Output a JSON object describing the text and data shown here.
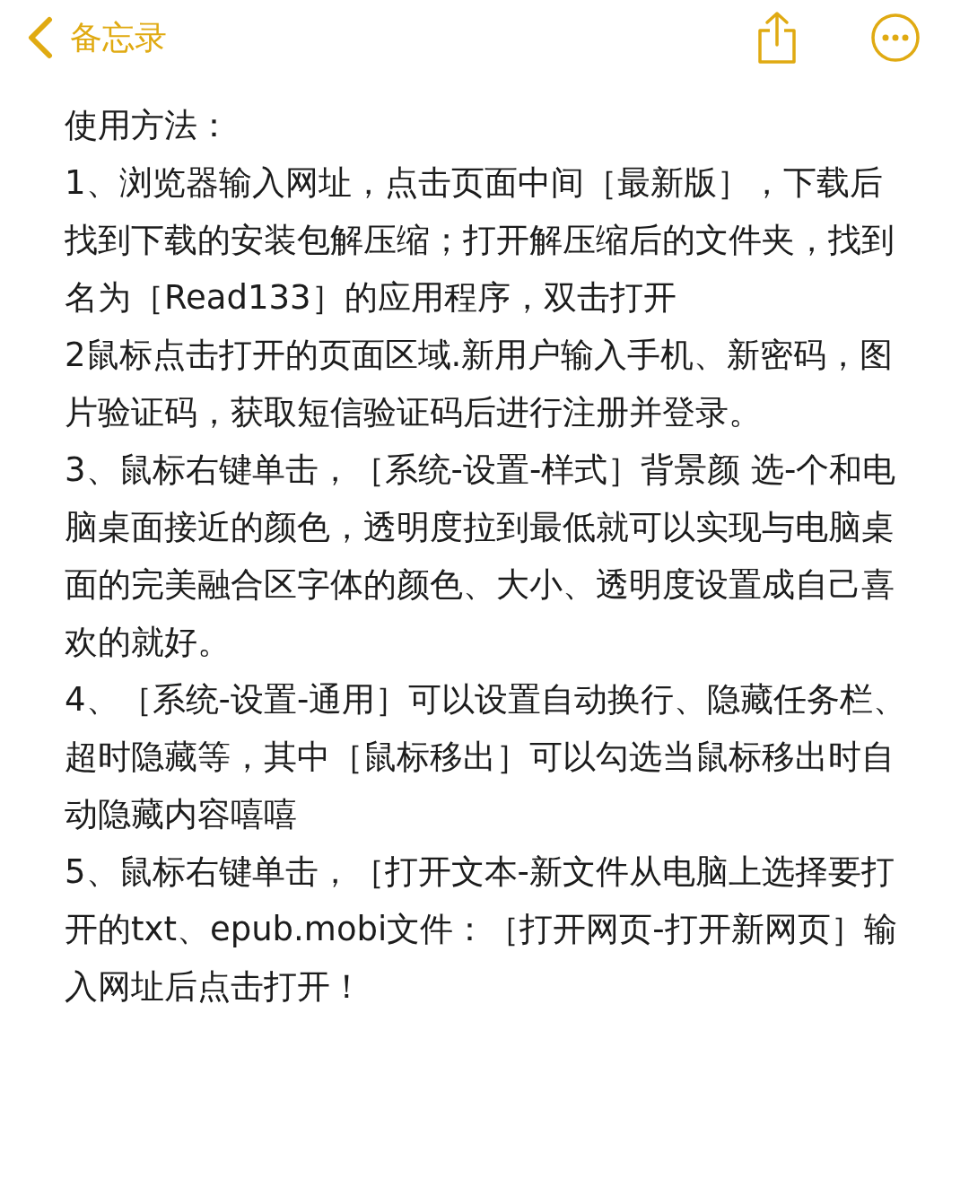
{
  "nav_bar": {
    "back_label": "备忘录"
  },
  "note": {
    "paragraphs": [
      "使用方法：",
      "1、浏览器输入网址，点击页面中间［最新版］，下载后找到下载的安装包解压缩；打开解压缩后的文件夹，找到名为［Read133］的应用程序，双击打开",
      "2鼠标点击打开的页面区域.新用户输入手机、新密码，图片验证码，获取短信验证码后进行注册并登录。",
      "3、鼠标右键单击，［系统-设置-样式］背景颜 选-个和电脑桌面接近的颜色，透明度拉到最低就可以实现与电脑桌面的完美融合区字体的颜色、大小、透明度设置成自己喜欢的就好。",
      "4、［系统-设置-通用］可以设置自动换行、隐藏任务栏、超时隐藏等，其中［鼠标移出］可以勾选当鼠标移出时自动隐藏内容嘻嘻",
      "5、鼠标右键单击，［打开文本-新文件从电脑上选择要打开的txt、epub.mobi文件：［打开网页-打开新网页］输入网址后点击打开！"
    ]
  }
}
